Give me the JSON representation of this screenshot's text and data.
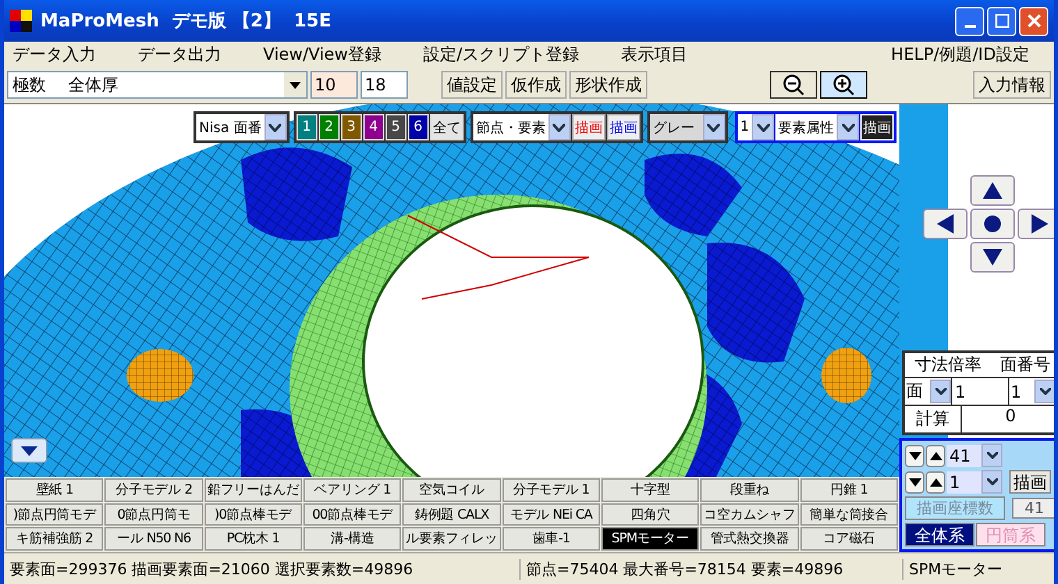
{
  "window": {
    "title": "MaProMesh  デモ版 【2】  15E"
  },
  "menu": [
    "データ入力",
    "データ出力",
    "View/View登録",
    "設定/スクリプト登録",
    "表示項目",
    "HELP/例題/ID設定"
  ],
  "toolbar": {
    "combo_label": "極数",
    "combo_value": "全体厚",
    "field_1": "10",
    "field_2": "18",
    "buttons": [
      "値設定",
      "仮作成",
      "形状作成"
    ],
    "info_button": "入力情報"
  },
  "view_toolbar": {
    "face_select": "Nisa 面番",
    "face_buttons": [
      {
        "label": "1",
        "color": "#008080"
      },
      {
        "label": "2",
        "color": "#008000"
      },
      {
        "label": "3",
        "color": "#805800"
      },
      {
        "label": "4",
        "color": "#900090"
      },
      {
        "label": "5",
        "color": "#484848"
      },
      {
        "label": "6",
        "color": "#0000a8"
      }
    ],
    "all_button": "全て",
    "node_select": "節点・要素",
    "draw_red": "描画",
    "draw_blue": "描画",
    "color_select": "グレー",
    "number_select": "1",
    "attribute_select": "要素属性",
    "draw_button": "描画"
  },
  "dimension_panel": {
    "headers": [
      "寸法倍率",
      "面番号"
    ],
    "select": "面",
    "field": "1",
    "number_select": "1",
    "calc_button": "計算",
    "result": "0"
  },
  "model_buttons": [
    [
      {
        "label": "壁紙 1",
        "selected": false
      },
      {
        "label": "分子モデル 2",
        "selected": false
      },
      {
        "label": "鉛フリーはんだ",
        "selected": false
      },
      {
        "label": "ベアリング 1",
        "selected": false
      },
      {
        "label": "空気コイル",
        "selected": false
      },
      {
        "label": "分子モデル 1",
        "selected": false
      },
      {
        "label": "十字型",
        "selected": false
      },
      {
        "label": "段重ね",
        "selected": false
      },
      {
        "label": "円錐 1",
        "selected": false
      }
    ],
    [
      {
        "label": ")節点円筒モデ",
        "selected": false
      },
      {
        "label": "0節点円筒モ",
        "selected": false
      },
      {
        "label": ")0節点棒モデ",
        "selected": false
      },
      {
        "label": "00節点棒モデ",
        "selected": false
      },
      {
        "label": "鋳例題 CALX",
        "selected": false
      },
      {
        "label": "モデル NEi CA",
        "selected": false
      },
      {
        "label": "四角穴",
        "selected": false
      },
      {
        "label": "コ空カムシャフ",
        "selected": false
      },
      {
        "label": "簡単な筒接合",
        "selected": false
      }
    ],
    [
      {
        "label": "キ筋補強筋 2",
        "selected": false
      },
      {
        "label": "ール N50 N6",
        "selected": false
      },
      {
        "label": "PC枕木 1",
        "selected": false
      },
      {
        "label": "溝-構造",
        "selected": false
      },
      {
        "label": "ル要素フィレッ",
        "selected": false
      },
      {
        "label": "歯車-1",
        "selected": false
      },
      {
        "label": "SPMモーター",
        "selected": true
      },
      {
        "label": "管式熱交換器",
        "selected": false
      },
      {
        "label": "コア磁石",
        "selected": false
      }
    ]
  ],
  "lower_panel": {
    "spin_1": "41",
    "spin_2": "1",
    "draw_button": "描画",
    "coord_label": "描画座標数",
    "coord_value": "41",
    "tabs": [
      {
        "label": "全体系",
        "selected": true
      },
      {
        "label": "円筒系",
        "selected": false
      }
    ]
  },
  "status_bar": [
    "要素面=299376 描画要素面=21060 選択要素数=49896",
    "節点=75404 最大番号=78154 要素=49896",
    "SPMモーター"
  ]
}
